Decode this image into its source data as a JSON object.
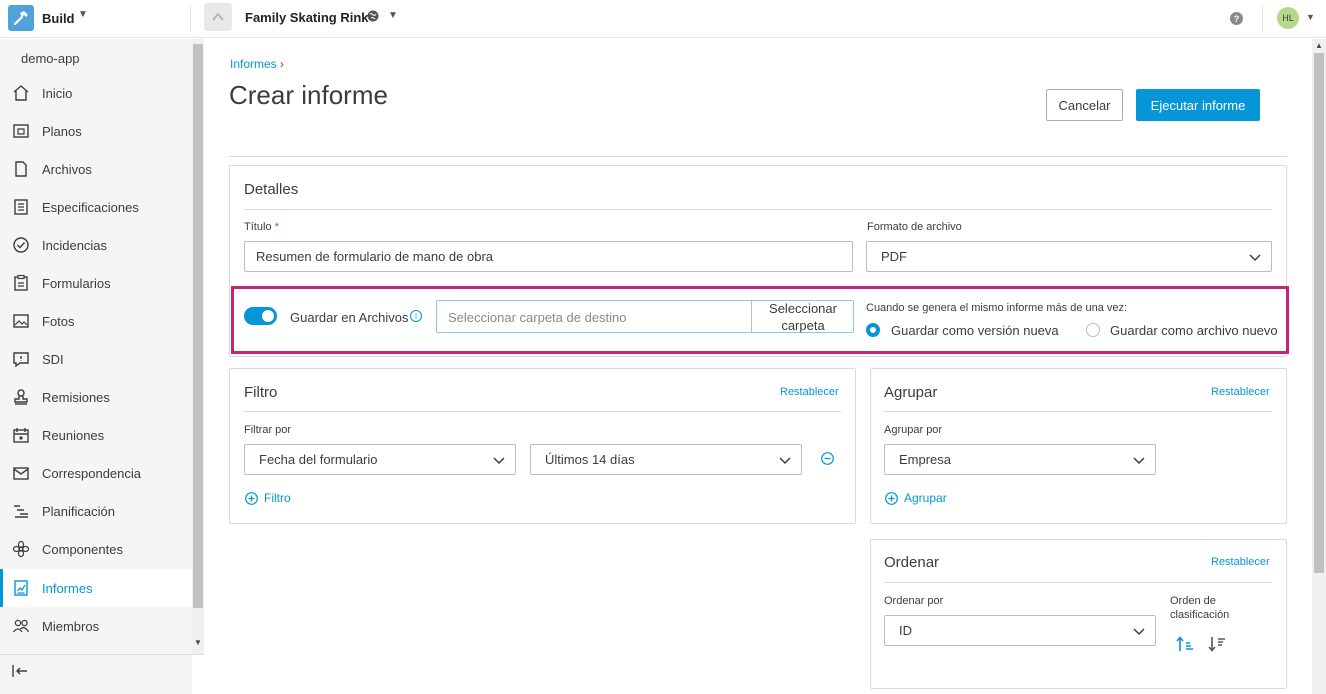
{
  "topbar": {
    "product": "Build",
    "project": "Family Skating Rink",
    "avatar_initials": "HL"
  },
  "sidebar": {
    "app_name": "demo-app",
    "items": [
      {
        "label": "Inicio",
        "icon": "home-icon"
      },
      {
        "label": "Planos",
        "icon": "sheets-icon"
      },
      {
        "label": "Archivos",
        "icon": "files-icon"
      },
      {
        "label": "Especificaciones",
        "icon": "specifications-icon"
      },
      {
        "label": "Incidencias",
        "icon": "issues-icon"
      },
      {
        "label": "Formularios",
        "icon": "forms-icon"
      },
      {
        "label": "Fotos",
        "icon": "photos-icon"
      },
      {
        "label": "SDI",
        "icon": "rfi-icon"
      },
      {
        "label": "Remisiones",
        "icon": "submittals-icon"
      },
      {
        "label": "Reuniones",
        "icon": "meetings-icon"
      },
      {
        "label": "Correspondencia",
        "icon": "mail-icon"
      },
      {
        "label": "Planificación",
        "icon": "schedule-icon"
      },
      {
        "label": "Componentes",
        "icon": "assets-icon"
      },
      {
        "label": "Informes",
        "icon": "reports-icon",
        "active": true
      },
      {
        "label": "Miembros",
        "icon": "members-icon"
      }
    ]
  },
  "header": {
    "breadcrumb": "Informes",
    "title": "Crear informe",
    "cancel_label": "Cancelar",
    "run_label": "Ejecutar informe"
  },
  "details": {
    "title": "Detalles",
    "title_label": "Título",
    "title_required": "*",
    "title_value": "Resumen de formulario de mano de obra",
    "format_label": "Formato de archivo",
    "format_value": "PDF",
    "save_toggle_label": "Guardar en Archivos",
    "save_toggle_on": true,
    "folder_placeholder": "Seleccionar carpeta de destino",
    "folder_button_line1": "Seleccionar",
    "folder_button_line2": "carpeta",
    "duplicate_label": "Cuando se genera el mismo informe más de una vez:",
    "option_new_version": "Guardar como versión nueva",
    "option_new_file": "Guardar como archivo nuevo",
    "selected_option": "new_version",
    "highlight_color": "#c0267f"
  },
  "filter": {
    "title": "Filtro",
    "reset": "Restablecer",
    "filter_by_label": "Filtrar por",
    "field_value": "Fecha del formulario",
    "range_value": "Últimos 14 días",
    "add_label": "Filtro"
  },
  "group": {
    "title": "Agrupar",
    "reset": "Restablecer",
    "group_by_label": "Agrupar por",
    "value": "Empresa",
    "add_label": "Agrupar"
  },
  "sort": {
    "title": "Ordenar",
    "reset": "Restablecer",
    "sort_by_label": "Ordenar por",
    "value": "ID",
    "order_label_line1": "Orden de",
    "order_label_line2": "clasificación"
  },
  "colors": {
    "accent": "#0696d7"
  }
}
